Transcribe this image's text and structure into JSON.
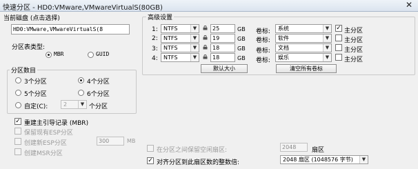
{
  "window": {
    "title": "快速分区 - HD0:VMware,VMwareVirtualS(80GB)",
    "close_glyph": "✕"
  },
  "current_disk": {
    "label": "当前磁盘 (点击选择)",
    "value": "HD0:VMware,VMwareVirtualS(8"
  },
  "partition_table": {
    "label": "分区表类型:",
    "options": [
      "MBR",
      "GUID"
    ],
    "selected": "MBR"
  },
  "partition_count": {
    "label": "分区数目",
    "options": [
      "3个分区",
      "4个分区",
      "5个分区",
      "6个分区"
    ],
    "selected": "4个分区",
    "custom_label": "自定(C):",
    "custom_value": "2",
    "custom_suffix": "个分区"
  },
  "options": {
    "rebuild_mbr": "重建主引导记录 (MBR)",
    "keep_esp": "保留现有ESP分区",
    "create_esp": "创建新ESP分区",
    "esp_size": "300",
    "esp_unit": "MB",
    "create_msr": "创建MSR分区"
  },
  "advanced": {
    "label": "高级设置",
    "volume_label_text": "卷标:",
    "primary_text": "主分区",
    "gb_text": "GB",
    "rows": [
      {
        "index": "1:",
        "fs": "NTFS",
        "size": "25",
        "volume": "系统",
        "primary": true
      },
      {
        "index": "2:",
        "fs": "NTFS",
        "size": "19",
        "volume": "软件",
        "primary": false
      },
      {
        "index": "3:",
        "fs": "NTFS",
        "size": "18",
        "volume": "文档",
        "primary": false
      },
      {
        "index": "4:",
        "fs": "NTFS",
        "size": "18",
        "volume": "娱乐",
        "primary": false
      }
    ],
    "default_size_btn": "默认大小",
    "clear_labels_btn": "清空所有卷标"
  },
  "gap": {
    "label": "在分区之间保留空闲扇区:",
    "value": "2048",
    "unit": "扇区"
  },
  "align": {
    "label": "对齐分区到此扇区数的整数倍:",
    "value": "2048 扇区 (1048576 字节)"
  }
}
